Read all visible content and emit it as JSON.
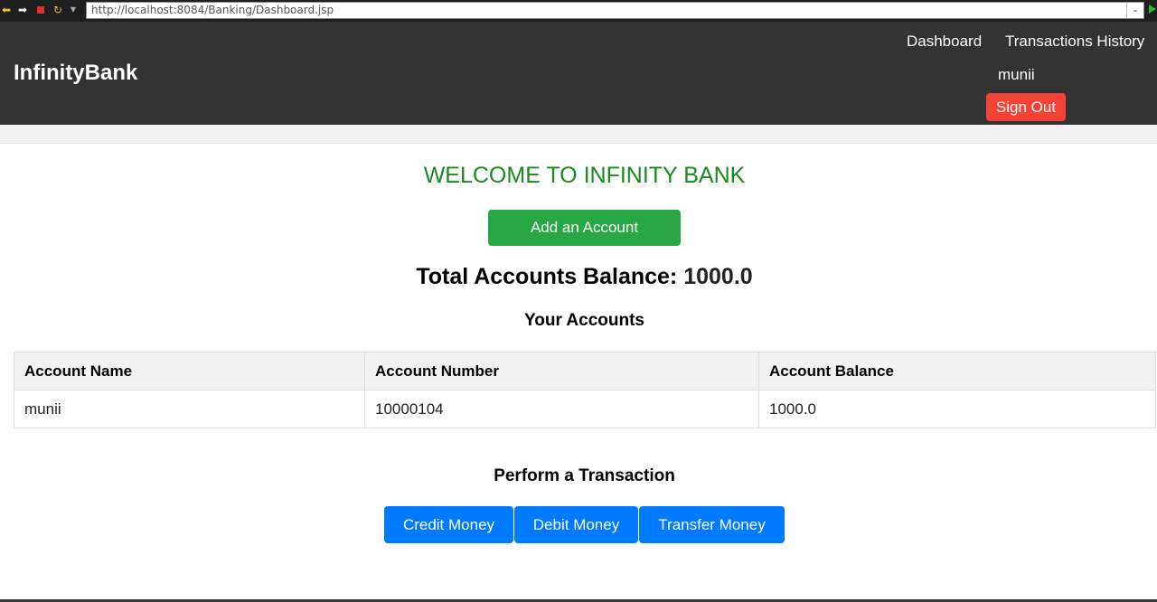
{
  "browser": {
    "url": "http://localhost:8084/Banking/Dashboard.jsp",
    "icons": [
      "back-arrow-icon",
      "forward-arrow-icon",
      "stop-icon",
      "refresh-icon",
      "dropdown-icon",
      "go-icon"
    ]
  },
  "header": {
    "brand": "InfinityBank",
    "nav": {
      "dashboard": "Dashboard",
      "transactions_history": "Transactions History"
    },
    "username": "munii",
    "signout_label": "Sign Out"
  },
  "main": {
    "welcome": "WELCOME TO INFINITY BANK",
    "add_account_label": "Add an Account",
    "total_label": "Total Accounts Balance:",
    "total_value": "1000.0",
    "accounts_title": "Your Accounts",
    "table": {
      "headers": [
        "Account Name",
        "Account Number",
        "Account Balance"
      ],
      "rows": [
        [
          "munii",
          "10000104",
          "1000.0"
        ]
      ]
    },
    "transaction_title": "Perform a Transaction",
    "transaction_buttons": {
      "credit": "Credit Money",
      "debit": "Debit Money",
      "transfer": "Transfer Money"
    }
  },
  "colors": {
    "header_bg": "#333333",
    "welcome_green": "#198a1e",
    "add_button_green": "#28a745",
    "signout_red": "#f44336",
    "action_blue": "#007bff"
  }
}
